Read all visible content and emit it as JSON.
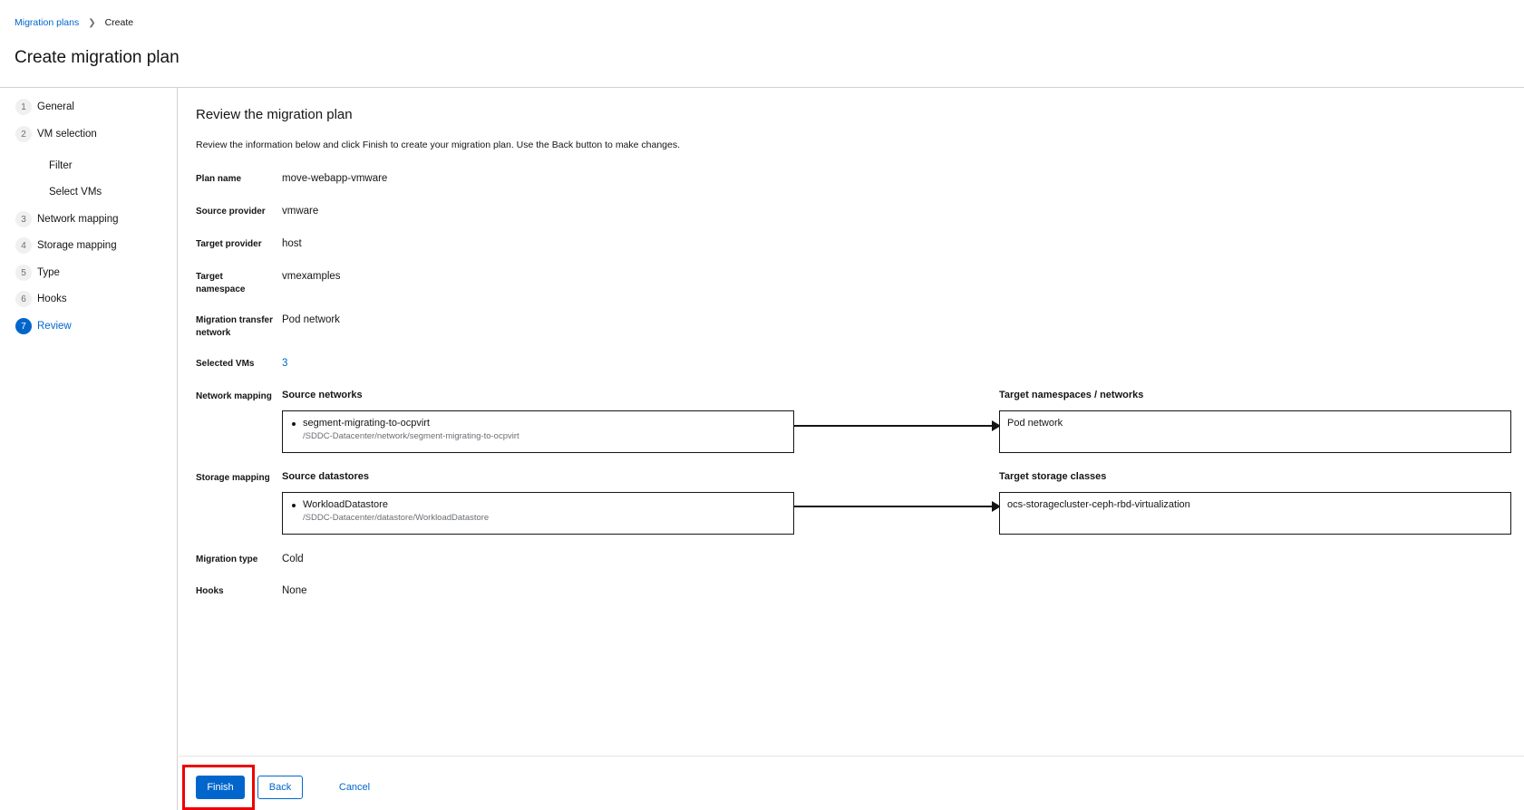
{
  "breadcrumb": {
    "parent": "Migration plans",
    "current": "Create"
  },
  "page_title": "Create migration plan",
  "nav": {
    "steps": [
      {
        "num": "1",
        "label": "General"
      },
      {
        "num": "2",
        "label": "VM selection"
      },
      {
        "num": "3",
        "label": "Network mapping"
      },
      {
        "num": "4",
        "label": "Storage mapping"
      },
      {
        "num": "5",
        "label": "Type"
      },
      {
        "num": "6",
        "label": "Hooks"
      },
      {
        "num": "7",
        "label": "Review"
      }
    ],
    "substeps": [
      "Filter",
      "Select VMs"
    ],
    "active_step": "7"
  },
  "review": {
    "title": "Review the migration plan",
    "description": "Review the information below and click Finish to create your migration plan. Use the Back button to make changes.",
    "fields": {
      "plan_name": {
        "term": "Plan name",
        "value": "move-webapp-vmware"
      },
      "source_provider": {
        "term": "Source provider",
        "value": "vmware"
      },
      "target_provider": {
        "term": "Target provider",
        "value": "host"
      },
      "target_namespace": {
        "term": "Target namespace",
        "value": "vmexamples"
      },
      "transfer_network": {
        "term": "Migration transfer network",
        "value": "Pod network"
      },
      "selected_vms": {
        "term": "Selected VMs",
        "value": "3"
      },
      "migration_type": {
        "term": "Migration type",
        "value": "Cold"
      },
      "hooks": {
        "term": "Hooks",
        "value": "None"
      }
    },
    "network_mapping": {
      "term": "Network mapping",
      "source_heading": "Source networks",
      "target_heading": "Target namespaces / networks",
      "source_name": "segment-migrating-to-ocpvirt",
      "source_path": "/SDDC-Datacenter/network/segment-migrating-to-ocpvirt",
      "target": "Pod network"
    },
    "storage_mapping": {
      "term": "Storage mapping",
      "source_heading": "Source datastores",
      "target_heading": "Target storage classes",
      "source_name": "WorkloadDatastore",
      "source_path": "/SDDC-Datacenter/datastore/WorkloadDatastore",
      "target": "ocs-storagecluster-ceph-rbd-virtualization"
    }
  },
  "footer": {
    "finish_label": "Finish",
    "back_label": "Back",
    "cancel_label": "Cancel"
  },
  "colors": {
    "accent": "#0066cc",
    "highlight": "#ee0000"
  }
}
